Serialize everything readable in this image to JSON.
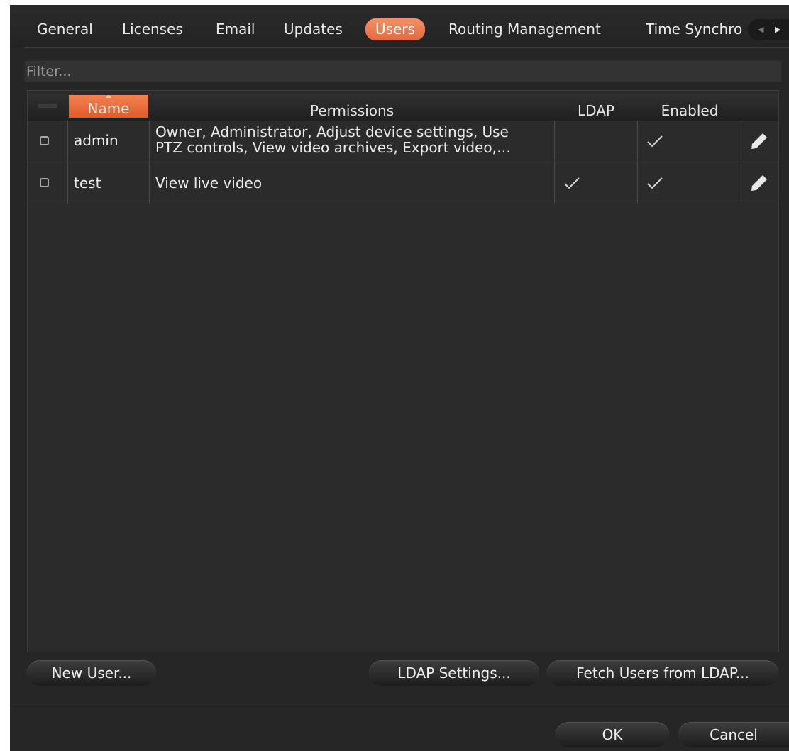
{
  "tabs": [
    {
      "label": "General",
      "active": false
    },
    {
      "label": "Licenses",
      "active": false
    },
    {
      "label": "Email",
      "active": false
    },
    {
      "label": "Updates",
      "active": false
    },
    {
      "label": "Users",
      "active": true
    },
    {
      "label": "Routing Management",
      "active": false
    },
    {
      "label": "Time Synchro",
      "active": false
    }
  ],
  "tab_scroll": {
    "left_icon": "triangle-left",
    "right_icon": "triangle-right"
  },
  "filter": {
    "placeholder": "Filter...",
    "value": ""
  },
  "table": {
    "columns": [
      "Name",
      "Permissions",
      "LDAP",
      "Enabled"
    ],
    "sorted_column": "Name",
    "rows": [
      {
        "name": "admin",
        "permissions_line1": "Owner, Administrator, Adjust device settings, Use",
        "permissions_line2": "PTZ controls, View video archives, Export video,…",
        "ldap": false,
        "enabled": true
      },
      {
        "name": "test",
        "permissions_line1": "View live video",
        "permissions_line2": "",
        "ldap": true,
        "enabled": true
      }
    ]
  },
  "buttons": {
    "new_user": "New User...",
    "ldap_settings": "LDAP Settings...",
    "fetch_ldap": "Fetch Users from LDAP...",
    "ok": "OK",
    "cancel": "Cancel"
  },
  "colors": {
    "accent": "#ea6b3c",
    "background": "#262626",
    "text": "#e6e6e6"
  }
}
